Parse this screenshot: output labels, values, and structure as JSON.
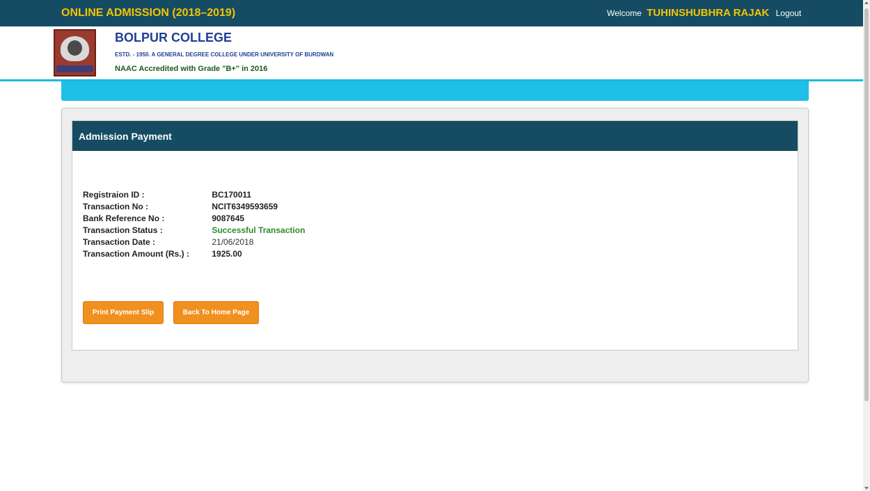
{
  "topbar": {
    "title": "ONLINE ADMISSION (2018–2019)",
    "welcome_label": "Welcome",
    "user_name": "TUHINSHUBHRA RAJAK",
    "logout_label": "Logout"
  },
  "header": {
    "college_name": "BOLPUR COLLEGE",
    "established": "ESTD. - 1950. A GENERAL DEGREE COLLEGE UNDER UNIVERSITY OF BURDWAN",
    "accreditation": "NAAC Accredited with Grade \"B+\" in 2016"
  },
  "panel": {
    "title": "Admission Payment"
  },
  "details": [
    {
      "label": "Registraion ID :",
      "value": "BC170011"
    },
    {
      "label": "Transaction No :",
      "value": "NCIT6349593659"
    },
    {
      "label": "Bank Reference No :",
      "value": "9087645"
    },
    {
      "label": "Transaction Status :",
      "value": "Successful Transaction"
    },
    {
      "label": "Transaction Date :",
      "value": "21/06/2018"
    },
    {
      "label": "Transaction Amount (Rs.) :",
      "value": "1925.00"
    }
  ],
  "buttons": {
    "print_label": "Print Payment Slip",
    "home_label": "Back To Home Page"
  },
  "colors": {
    "header_bg": "#154c63",
    "accent_yellow": "#f5c400",
    "nav_strip": "#1ec0e8",
    "button_orange": "#f0901e",
    "success_green": "#2e8b2e"
  }
}
